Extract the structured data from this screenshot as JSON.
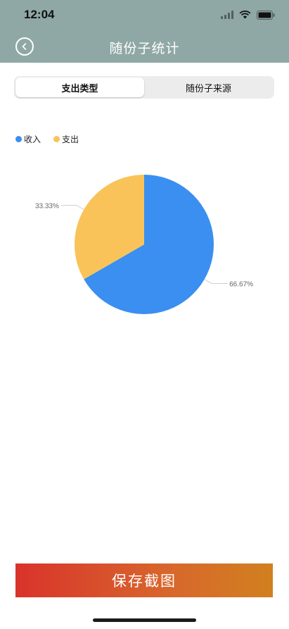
{
  "status_bar": {
    "time": "12:04"
  },
  "nav": {
    "title": "随份子统计",
    "back_icon": "chevron-left-icon"
  },
  "tabs": [
    {
      "label": "支出类型",
      "active": true
    },
    {
      "label": "随份子来源",
      "active": false
    }
  ],
  "legend": [
    {
      "label": "收入",
      "color": "#3a8ff0"
    },
    {
      "label": "支出",
      "color": "#f9c35a"
    }
  ],
  "chart_data": {
    "type": "pie",
    "slices": [
      {
        "name": "收入",
        "value": 66.67,
        "label": "66.67%",
        "color": "#3a8ff0"
      },
      {
        "name": "支出",
        "value": 33.33,
        "label": "33.33%",
        "color": "#f9c35a"
      }
    ],
    "legend_position": "top-left"
  },
  "actions": {
    "save_label": "保存截图"
  }
}
